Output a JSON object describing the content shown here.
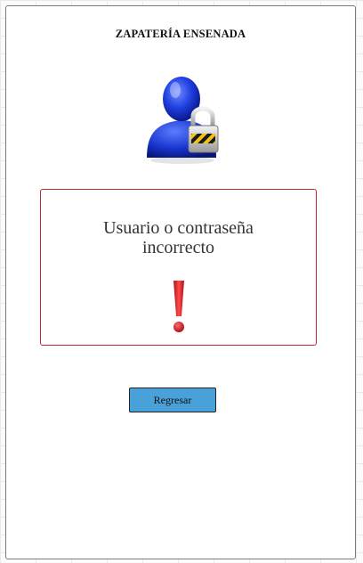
{
  "header": {
    "title": "ZAPATERÍA ENSENADA"
  },
  "icons": {
    "user": "user-lock-icon",
    "alert": "exclamation-icon"
  },
  "error": {
    "line1": "Usuario o contraseña",
    "line2": "incorrecto"
  },
  "actions": {
    "back_label": "Regresar"
  },
  "colors": {
    "button": "#4aa0d8",
    "error_border": "#c0282d",
    "exclamation": "#d81e2a"
  }
}
